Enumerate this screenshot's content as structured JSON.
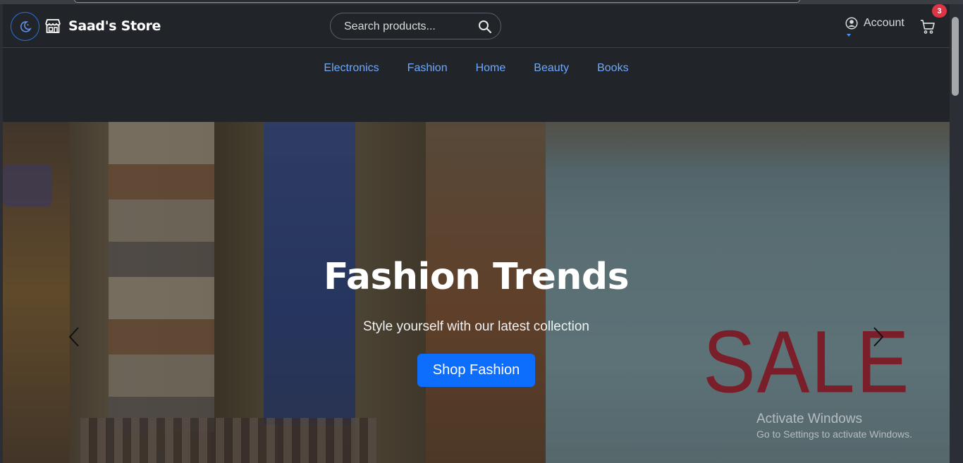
{
  "header": {
    "brand": "Saad's Store",
    "search_placeholder": "Search products...",
    "account_label": "Account",
    "cart_count": "3"
  },
  "categories": [
    "Electronics",
    "Fashion",
    "Home",
    "Beauty",
    "Books"
  ],
  "hero": {
    "title": "Fashion Trends",
    "subtitle": "Style yourself with our latest collection",
    "button_label": "Shop Fashion",
    "sign_text": "SALE"
  },
  "watermark": {
    "title": "Activate Windows",
    "subtitle": "Go to Settings to activate Windows."
  },
  "colors": {
    "background": "#212529",
    "accent": "#0d6efd",
    "link": "#6ea8fe",
    "badge": "#dc3545"
  },
  "icons": [
    "moon-icon",
    "store-icon",
    "search-icon",
    "user-circle-icon",
    "cart-icon",
    "chevron-left-icon",
    "chevron-right-icon"
  ]
}
